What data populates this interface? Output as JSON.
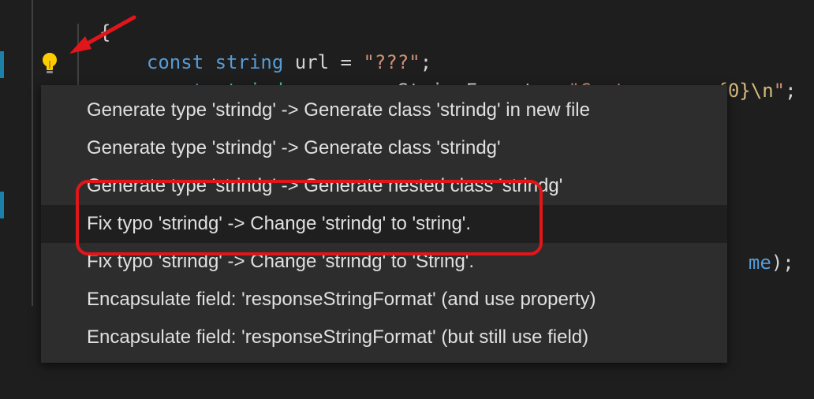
{
  "editor": {
    "line_brace_open": "{",
    "line1": {
      "kw": "const",
      "type": "string",
      "name": " url = ",
      "str": "\"???\"",
      "end": ";"
    },
    "line2": {
      "kw": "const",
      "type": "strindg",
      "name": " responseStringFormat = ",
      "str_a": "\"Customer => ",
      "esc1": "{0}",
      "esc2": "\\n",
      "str_b": "\"",
      "end": ";"
    },
    "partial_line": {
      "text_colored": "me",
      "text_rest": ");"
    },
    "line_brace_close": "}"
  },
  "quick_fix_menu": {
    "items": [
      {
        "label": "Generate type 'strindg' -> Generate class 'strindg' in new file"
      },
      {
        "label": "Generate type 'strindg' -> Generate class 'strindg'"
      },
      {
        "label": "Generate type 'strindg' -> Generate nested class 'strindg'"
      },
      {
        "label": "Fix typo 'strindg' -> Change 'strindg' to 'string'.",
        "selected": true
      },
      {
        "label": "Fix typo 'strindg' -> Change 'strindg' to 'String'."
      },
      {
        "label": "Encapsulate field: 'responseStringFormat' (and use property)"
      },
      {
        "label": "Encapsulate field: 'responseStringFormat' (but still use field)"
      }
    ]
  },
  "colors": {
    "editor_bg": "#1e1e1e",
    "menu_bg": "#2d2d2d",
    "keyword": "#569cd6",
    "type": "#4ec9b0",
    "string": "#ce9178",
    "annotation_red": "#e0161b",
    "lightbulb": "#ffcc00"
  },
  "icons": {
    "lightbulb": "lightbulb-icon",
    "annotation_arrow": "red-arrow-annotation"
  }
}
